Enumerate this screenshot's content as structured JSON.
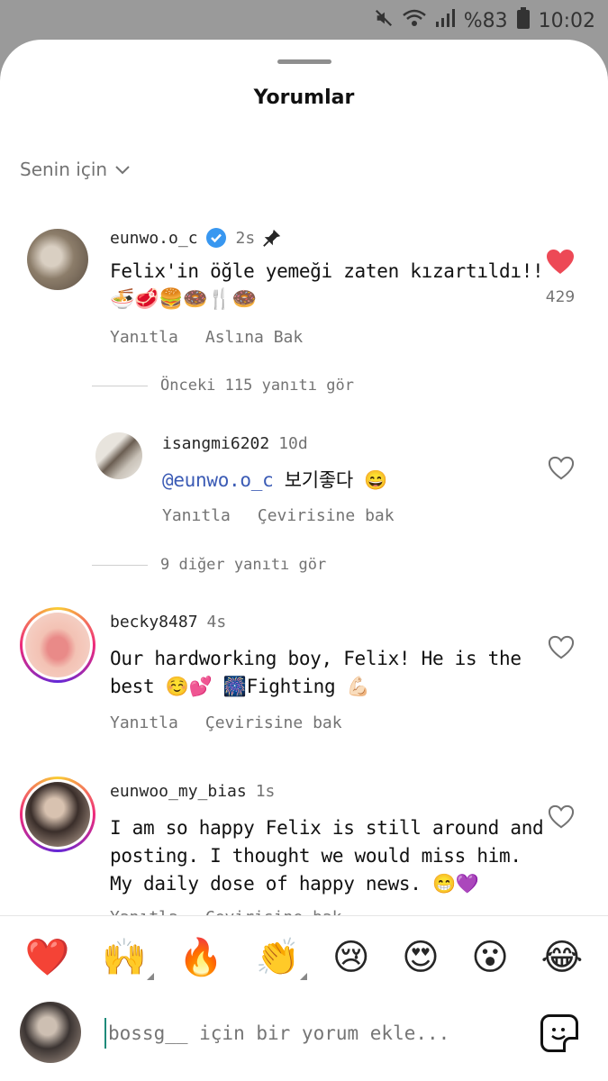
{
  "status": {
    "battery": "%83",
    "time": "10:02"
  },
  "sheet": {
    "title": "Yorumlar",
    "filter_label": "Senin için"
  },
  "comments": [
    {
      "username": "eunwo.o_c",
      "time": "2s",
      "verified": true,
      "pinned": true,
      "text_line1": "Felix'in öğle yemeği zaten kızartıldı!!",
      "text_line2": "🍜🥩🍔🍩🍴🍩",
      "reply_label": "Yanıtla",
      "secondary_action": "Aslına Bak",
      "likes": "429",
      "liked": true,
      "view_more": "Önceki 115 yanıtı gör"
    },
    {
      "username": "isangmi6202",
      "time": "10d",
      "mention": "@eunwo.o_c",
      "text_rest": " 보기좋다 😄",
      "reply_label": "Yanıtla",
      "secondary_action": "Çevirisine bak",
      "view_more": "9 diğer yanıtı gör"
    },
    {
      "username": "becky8487",
      "time": "4s",
      "text_line1": "Our hardworking boy, Felix! He is the",
      "text_line2": "best ☺️💕 🎆Fighting 💪🏻",
      "reply_label": "Yanıtla",
      "secondary_action": "Çevirisine bak"
    },
    {
      "username": "eunwoo_my_bias",
      "time": "1s",
      "text_line1": "I am so happy Felix is still around and",
      "text_line2": "posting. I thought we would miss him.",
      "text_line3": "My daily dose of happy news. 😁💜",
      "reply_label": "Yanıtla",
      "secondary_action": "Çevirisine bak"
    }
  ],
  "quick_emojis": [
    "❤️",
    "🙌",
    "🔥",
    "👏",
    "😢",
    "😍",
    "😮",
    "😂"
  ],
  "compose": {
    "placeholder": "bossg__ için bir yorum ekle..."
  },
  "colors": {
    "like_red": "#ed4956",
    "mention_blue": "#3b5bb5",
    "verified_blue": "#3897f0"
  }
}
